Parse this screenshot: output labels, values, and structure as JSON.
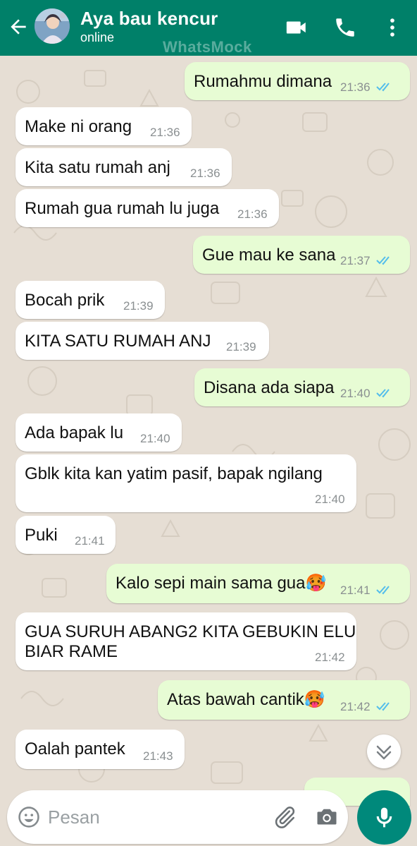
{
  "header": {
    "contact_name": "Aya bau kencur",
    "status": "online",
    "watermark": "WhatsMock"
  },
  "messages": [
    {
      "direction": "outgoing",
      "text": "Rumahmu dimana",
      "time": "21:36",
      "read": true
    },
    {
      "direction": "incoming",
      "text": "Make ni orang",
      "time": "21:36"
    },
    {
      "direction": "incoming",
      "text": "Kita satu rumah anj",
      "time": "21:36"
    },
    {
      "direction": "incoming",
      "text": "Rumah gua rumah lu juga",
      "time": "21:36"
    },
    {
      "direction": "outgoing",
      "text": "Gue mau ke sana",
      "time": "21:37",
      "read": true
    },
    {
      "direction": "incoming",
      "text": "Bocah prik",
      "time": "21:39"
    },
    {
      "direction": "incoming",
      "text": "KITA SATU RUMAH ANJ",
      "time": "21:39"
    },
    {
      "direction": "outgoing",
      "text": "Disana ada siapa",
      "time": "21:40",
      "read": true
    },
    {
      "direction": "incoming",
      "text": "Ada bapak lu",
      "time": "21:40"
    },
    {
      "direction": "incoming",
      "text": "Gblk kita kan yatim pasif, bapak ngilang",
      "time": "21:40"
    },
    {
      "direction": "incoming",
      "text": "Puki",
      "time": "21:41"
    },
    {
      "direction": "outgoing",
      "text": "Kalo sepi main sama gua🥵",
      "time": "21:41",
      "read": true
    },
    {
      "direction": "incoming",
      "text": "GUA SURUH ABANG2 KITA GEBUKIN ELU",
      "text2": "BIAR RAME",
      "time": "21:42"
    },
    {
      "direction": "outgoing",
      "text": "Atas bawah cantik🥵",
      "time": "21:42",
      "read": true
    },
    {
      "direction": "incoming",
      "text": "Oalah pantek",
      "time": "21:43"
    }
  ],
  "composer": {
    "placeholder": "Pesan"
  },
  "colors": {
    "header": "#008069",
    "outgoing_bubble": "#e7fcd4",
    "incoming_bubble": "#ffffff",
    "read_ticks": "#53bdeb",
    "mic_button": "#00897b",
    "background": "#e6ded4"
  },
  "icons": [
    "back-arrow-icon",
    "video-call-icon",
    "phone-icon",
    "more-vert-icon",
    "double-check-icon",
    "chevron-down-icon",
    "emoji-icon",
    "attach-icon",
    "camera-icon",
    "mic-icon"
  ]
}
